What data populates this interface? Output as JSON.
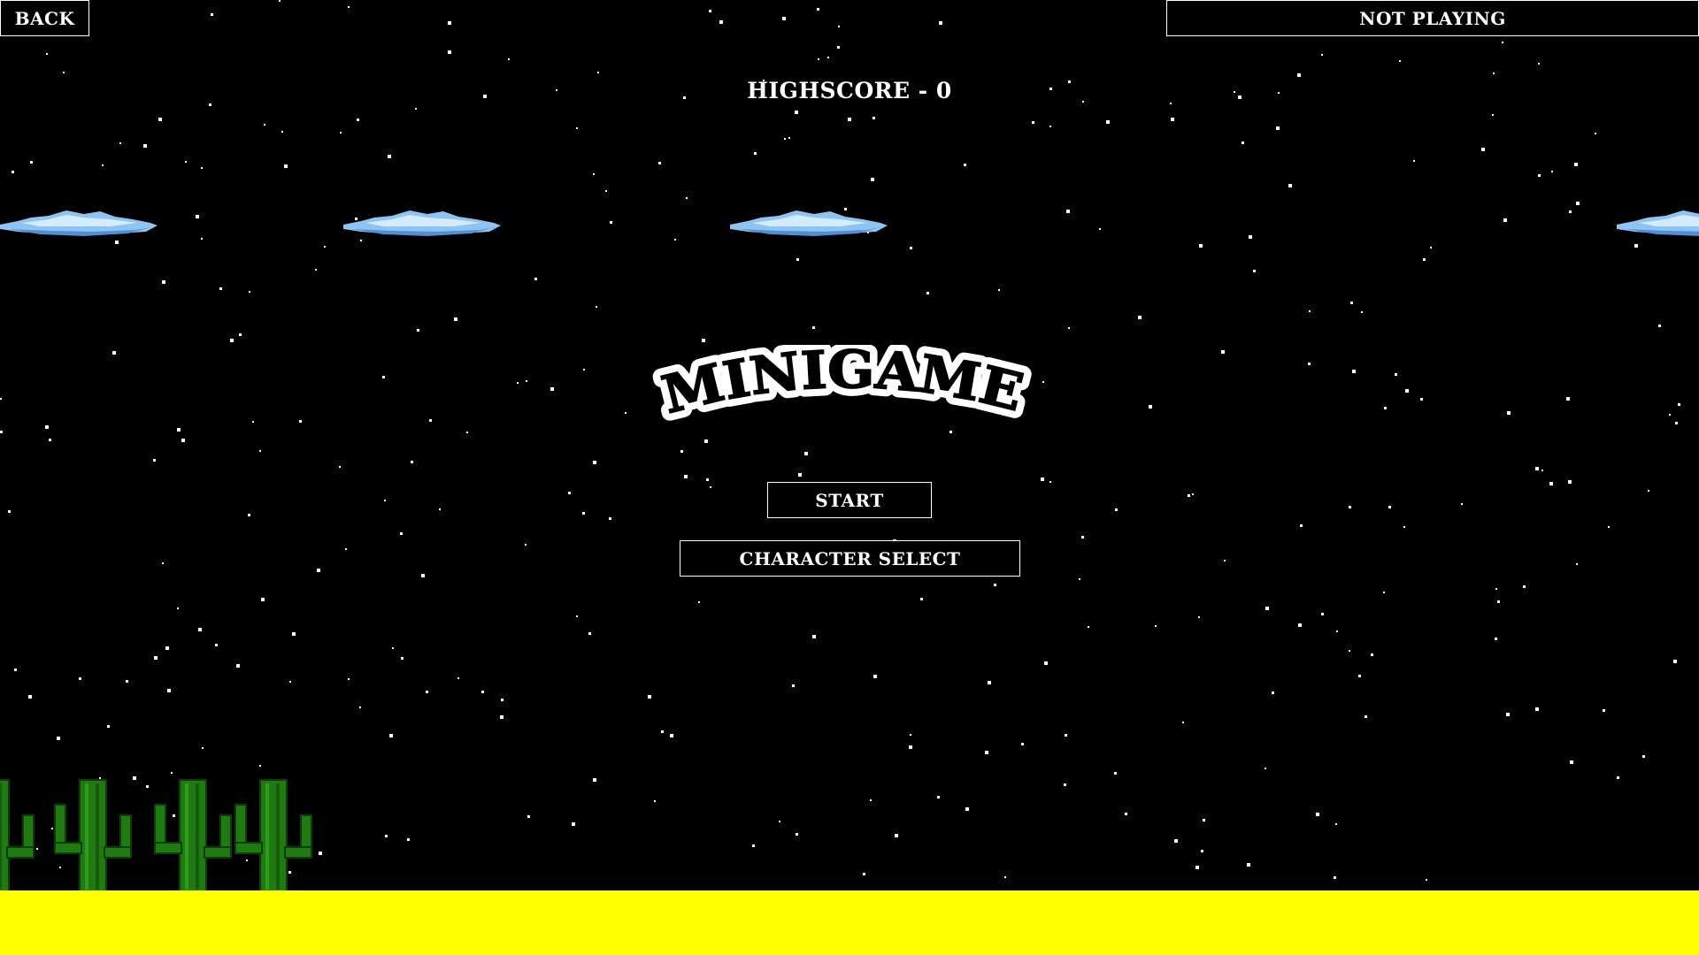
{
  "header": {
    "back_label": "BACK",
    "music_status": "NOT PLAYING"
  },
  "score": {
    "label": "HIGHSCORE",
    "separator": "-",
    "value": 0
  },
  "title": {
    "logo_text": "MINIGAME"
  },
  "menu": {
    "start_label": "START",
    "character_select_label": "CHARACTER SELECT"
  },
  "colors": {
    "background": "#000000",
    "ground": "#ffff00",
    "cactus": "#1f7a12",
    "cloud": "#8ec3f2",
    "text": "#ffffff"
  },
  "icons": {
    "cloud": "pixel-cloud-icon",
    "cactus": "pixel-cactus-icon"
  }
}
